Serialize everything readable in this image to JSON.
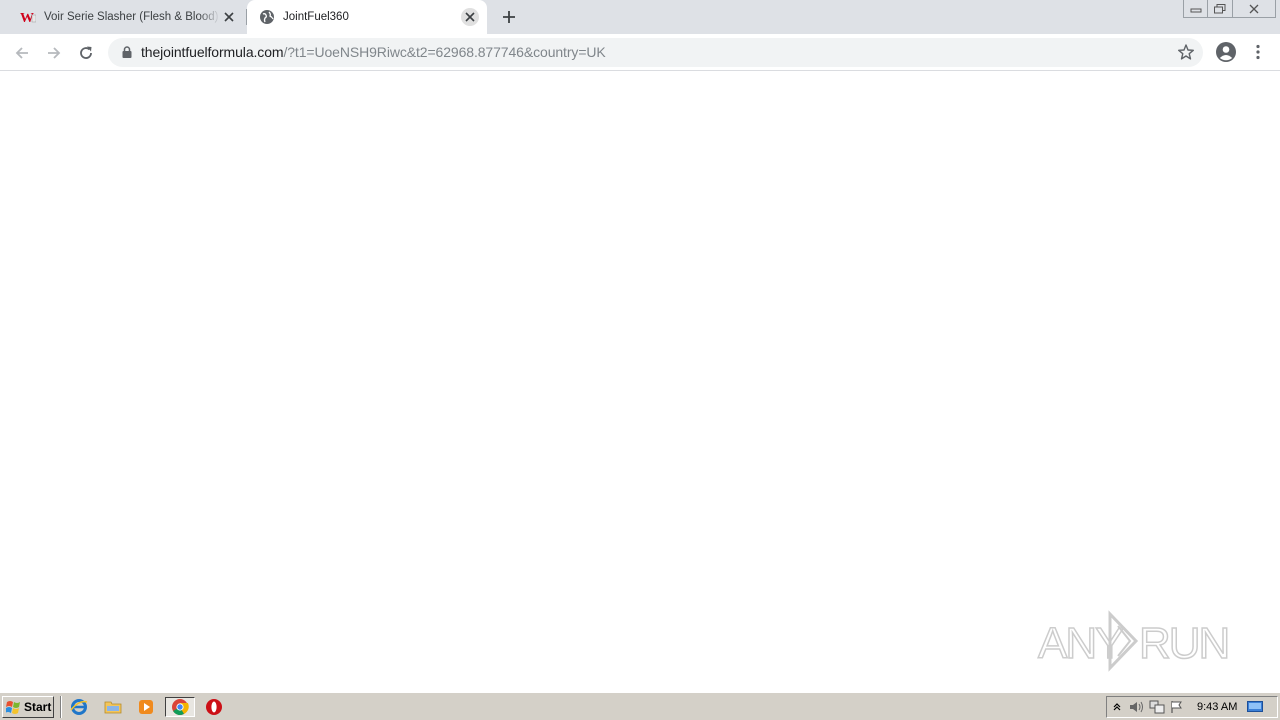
{
  "browser": {
    "tabs": [
      {
        "title": "Voir Serie Slasher (Flesh & Blood) - Saison",
        "favicon": "wordpress-w-icon",
        "active": false
      },
      {
        "title": "JointFuel360",
        "favicon": "globe-icon",
        "active": true
      }
    ],
    "new_tab_icon": "plus-icon",
    "address_bar": {
      "host": "thejointfuelformula.com",
      "path": "/?t1=UoeNSH9Riwc&t2=62968.877746&country=UK"
    }
  },
  "watermark": {
    "text": "ANY RUN"
  },
  "taskbar": {
    "start_label": "Start",
    "quick_launch": [
      "ie-icon",
      "explorer-folder-icon",
      "media-player-icon",
      "chrome-icon",
      "opera-icon"
    ],
    "tray": [
      "tray-expand-icon",
      "volume-icon",
      "network-icon",
      "action-center-flag-icon",
      "show-desktop-icon"
    ],
    "clock": "9:43 AM"
  },
  "colors": {
    "tabstrip": "#dee1e6",
    "omnibox": "#f1f3f4",
    "taskbar": "#d4d0c8",
    "url_host": "#202124",
    "url_rest": "#80868b"
  }
}
